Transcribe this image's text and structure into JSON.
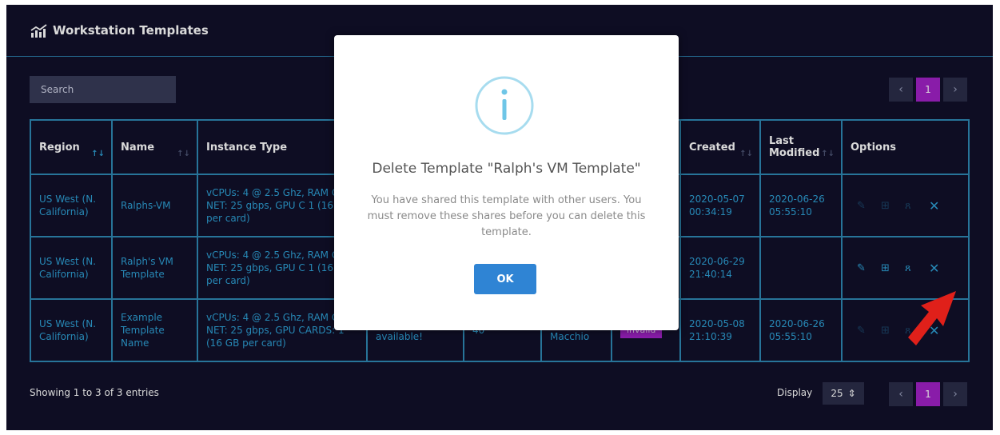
{
  "header": {
    "title": "Workstation Templates",
    "icon": "chart-icon"
  },
  "search": {
    "placeholder": "Search"
  },
  "pagination": {
    "prev": "‹",
    "page": "1",
    "next": "›"
  },
  "table": {
    "columns": [
      {
        "label": "Region"
      },
      {
        "label": "Name"
      },
      {
        "label": "Instance Type"
      },
      {
        "label": ""
      },
      {
        "label": ""
      },
      {
        "label": ""
      },
      {
        "label": ""
      },
      {
        "label": "Created"
      },
      {
        "label": "Last Modified"
      },
      {
        "label": "Options"
      }
    ],
    "rows": [
      {
        "region": "US West (N. California)",
        "name": "Ralphs-VM",
        "instance": "vCPUs: 4 @ 2.5 Ghz, RAM GB, NET: 25 gbps, GPU C 1 (16 GB per card)",
        "availability": "",
        "disk": "",
        "owner": "",
        "status": "",
        "created": "2020-05-07 00:34:19",
        "modified": "2020-06-26 05:55:10"
      },
      {
        "region": "US West (N. California)",
        "name": "Ralph's VM Template",
        "instance": "vCPUs: 4 @ 2.5 Ghz, RAM GB, NET: 25 gbps, GPU C 1 (16 GB per card)",
        "availability": "",
        "disk": "",
        "owner": "",
        "status": "",
        "created": "2020-06-29 21:40:14",
        "modified": ""
      },
      {
        "region": "US West (N. California)",
        "name": "Example Template Name",
        "instance": "vCPUs: 4 @ 2.5 Ghz, RAM GB, NET: 25 gbps, GPU CARDS: 1 (16 GB per card)",
        "availability": "longer available!",
        "disk": "40",
        "owner": "Ralph Macchio",
        "status": "invalid",
        "created": "2020-05-08 21:10:39",
        "modified": "2020-06-26 05:55:10"
      }
    ]
  },
  "footer": {
    "info": "Showing 1 to 3 of 3 entries",
    "display_label": "Display",
    "display_value": "25"
  },
  "modal": {
    "title": "Delete Template \"Ralph's VM Template\"",
    "text": "You have shared this template with other users. You must remove these shares before you can delete this template.",
    "ok_label": "OK"
  },
  "colors": {
    "panel_bg": "#11102a",
    "accent": "#2ea0d5",
    "purple": "#a122c7",
    "ok_button": "#2f84d4",
    "arrow": "#e0201a"
  }
}
